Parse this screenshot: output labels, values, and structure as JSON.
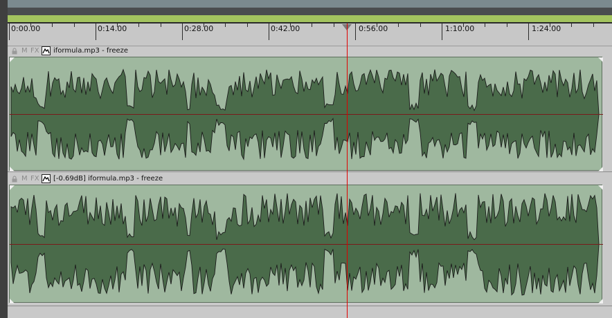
{
  "colors": {
    "ruler_bg": "#c7c7c7",
    "item_bg": "#9fb89f",
    "waveform_fill": "#4a6b4a",
    "cursor": "#e00000",
    "timebar_accent": "#a3c45f"
  },
  "ruler": {
    "ticks": [
      "0:00.00",
      "0:14.00",
      "0:28.00",
      "0:42.00",
      "0:56.00",
      "1:10.00",
      "1:24.00"
    ],
    "icon": "playhead-triangle-icon"
  },
  "tracks": [
    {
      "lock_icon": "lock-icon",
      "mute_label": "M",
      "fx_label": "FX",
      "envelope_icon": "envelope-icon",
      "name": "iformula.mp3 - freeze"
    },
    {
      "lock_icon": "lock-icon",
      "mute_label": "M",
      "fx_label": "FX",
      "envelope_icon": "envelope-icon",
      "name": "[-0.69dB] iformula.mp3 - freeze"
    }
  ]
}
